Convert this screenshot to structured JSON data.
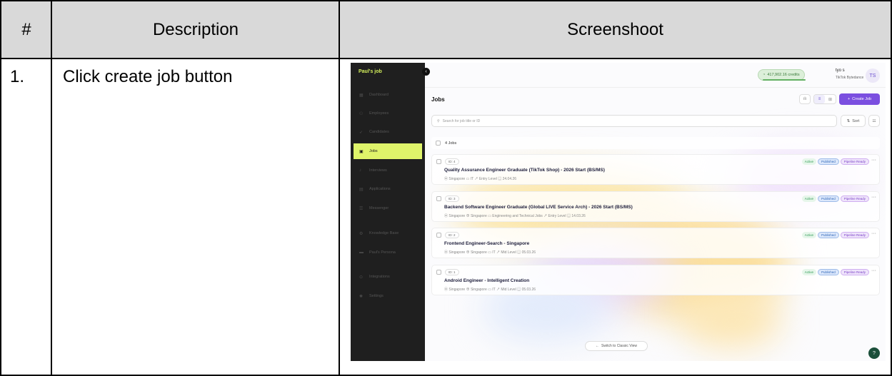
{
  "table": {
    "headers": [
      "#",
      "Description",
      "Screenshoot"
    ],
    "row": {
      "number": "1.",
      "description": "Click create job button"
    }
  },
  "app": {
    "logo": "Paul's job",
    "collapse_icon": "chevron-left-icon",
    "sidebar": [
      {
        "label": "Dashboard",
        "icon": "grid-icon",
        "active": false
      },
      {
        "label": "Employees",
        "icon": "user-icon",
        "active": false
      },
      {
        "label": "Candidates",
        "icon": "rocket-icon",
        "active": false
      },
      {
        "label": "Jobs",
        "icon": "briefcase-icon",
        "active": true
      },
      {
        "label": "Interviews",
        "icon": "mic-icon",
        "active": false
      },
      {
        "label": "Applications",
        "icon": "document-icon",
        "active": false
      },
      {
        "label": "Messenger",
        "icon": "message-icon",
        "active": false
      },
      {
        "label": "Knowledge Base",
        "icon": "gear-icon",
        "active": false
      },
      {
        "label": "Paul's Persona",
        "icon": "id-card-icon",
        "active": false
      },
      {
        "label": "Integrations",
        "icon": "plug-icon",
        "active": false
      },
      {
        "label": "Settings",
        "icon": "settings-icon",
        "active": false
      }
    ],
    "credits": "417,902.16 credits",
    "user": {
      "name": "tyo s",
      "org": "TikTok Bytedance",
      "initials": "TS"
    },
    "page_title": "Jobs",
    "create_label": "Create Job",
    "search_placeholder": "Search for job title or ID",
    "sort_label": "Sort",
    "filters_label": "Filters",
    "job_count": "4 Jobs",
    "badge_labels": {
      "active": "Active",
      "published": "Published",
      "pipeline": "Pipeline Ready"
    },
    "jobs": [
      {
        "id": "ID: 4",
        "title": "Quality Assurance Engineer Graduate (TikTok Shop) - 2026 Start (BS/MS)",
        "meta": "⦿ Singapore  ▭ IT  ↗ Entry Level  ▤ 24.04.26"
      },
      {
        "id": "ID: 3",
        "title": "Backend Software Engineer Graduate (Global LIVE Service Arch) - 2026 Start (BS/MS)",
        "meta": "⦿ Singapore  ⊕ Singapore  ▭ Engineering and Technical Jobs  ↗ Entry Level  ▤ 14.03.26"
      },
      {
        "id": "ID: 2",
        "title": "Frontend Engineer-Search - Singapore",
        "meta": "⦿ Singapore  ⊕ Singapore  ▭ IT  ↗ Mid Level  ▤ 05.03.26"
      },
      {
        "id": "ID: 1",
        "title": "Android Engineer - Intelligent Creation",
        "meta": "⦿ Singapore  ⊕ Singapore  ▭ IT  ↗ Mid Level  ▤ 05.03.26"
      }
    ],
    "switch_label": "Switch to Classic View",
    "colors": {
      "accent": "#7b4fe0",
      "sidebar_bg": "#1f1f1f",
      "active_nav": "#dff46a"
    }
  }
}
